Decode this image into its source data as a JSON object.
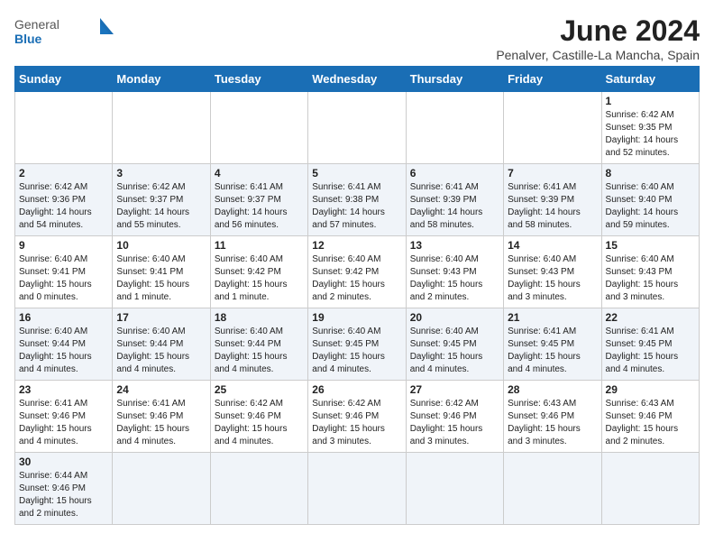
{
  "logo": {
    "text_general": "General",
    "text_blue": "Blue"
  },
  "header": {
    "title": "June 2024",
    "subtitle": "Penalver, Castille-La Mancha, Spain"
  },
  "days_of_week": [
    "Sunday",
    "Monday",
    "Tuesday",
    "Wednesday",
    "Thursday",
    "Friday",
    "Saturday"
  ],
  "weeks": [
    {
      "days": [
        {
          "num": "",
          "info": ""
        },
        {
          "num": "",
          "info": ""
        },
        {
          "num": "",
          "info": ""
        },
        {
          "num": "",
          "info": ""
        },
        {
          "num": "",
          "info": ""
        },
        {
          "num": "",
          "info": ""
        },
        {
          "num": "1",
          "info": "Sunrise: 6:42 AM\nSunset: 9:35 PM\nDaylight: 14 hours and 52 minutes."
        }
      ]
    },
    {
      "days": [
        {
          "num": "2",
          "info": "Sunrise: 6:42 AM\nSunset: 9:36 PM\nDaylight: 14 hours and 54 minutes."
        },
        {
          "num": "3",
          "info": "Sunrise: 6:42 AM\nSunset: 9:37 PM\nDaylight: 14 hours and 55 minutes."
        },
        {
          "num": "4",
          "info": "Sunrise: 6:41 AM\nSunset: 9:37 PM\nDaylight: 14 hours and 56 minutes."
        },
        {
          "num": "5",
          "info": "Sunrise: 6:41 AM\nSunset: 9:38 PM\nDaylight: 14 hours and 57 minutes."
        },
        {
          "num": "6",
          "info": "Sunrise: 6:41 AM\nSunset: 9:39 PM\nDaylight: 14 hours and 58 minutes."
        },
        {
          "num": "7",
          "info": "Sunrise: 6:41 AM\nSunset: 9:39 PM\nDaylight: 14 hours and 58 minutes."
        },
        {
          "num": "8",
          "info": "Sunrise: 6:40 AM\nSunset: 9:40 PM\nDaylight: 14 hours and 59 minutes."
        }
      ]
    },
    {
      "days": [
        {
          "num": "9",
          "info": "Sunrise: 6:40 AM\nSunset: 9:41 PM\nDaylight: 15 hours and 0 minutes."
        },
        {
          "num": "10",
          "info": "Sunrise: 6:40 AM\nSunset: 9:41 PM\nDaylight: 15 hours and 1 minute."
        },
        {
          "num": "11",
          "info": "Sunrise: 6:40 AM\nSunset: 9:42 PM\nDaylight: 15 hours and 1 minute."
        },
        {
          "num": "12",
          "info": "Sunrise: 6:40 AM\nSunset: 9:42 PM\nDaylight: 15 hours and 2 minutes."
        },
        {
          "num": "13",
          "info": "Sunrise: 6:40 AM\nSunset: 9:43 PM\nDaylight: 15 hours and 2 minutes."
        },
        {
          "num": "14",
          "info": "Sunrise: 6:40 AM\nSunset: 9:43 PM\nDaylight: 15 hours and 3 minutes."
        },
        {
          "num": "15",
          "info": "Sunrise: 6:40 AM\nSunset: 9:43 PM\nDaylight: 15 hours and 3 minutes."
        }
      ]
    },
    {
      "days": [
        {
          "num": "16",
          "info": "Sunrise: 6:40 AM\nSunset: 9:44 PM\nDaylight: 15 hours and 4 minutes."
        },
        {
          "num": "17",
          "info": "Sunrise: 6:40 AM\nSunset: 9:44 PM\nDaylight: 15 hours and 4 minutes."
        },
        {
          "num": "18",
          "info": "Sunrise: 6:40 AM\nSunset: 9:44 PM\nDaylight: 15 hours and 4 minutes."
        },
        {
          "num": "19",
          "info": "Sunrise: 6:40 AM\nSunset: 9:45 PM\nDaylight: 15 hours and 4 minutes."
        },
        {
          "num": "20",
          "info": "Sunrise: 6:40 AM\nSunset: 9:45 PM\nDaylight: 15 hours and 4 minutes."
        },
        {
          "num": "21",
          "info": "Sunrise: 6:41 AM\nSunset: 9:45 PM\nDaylight: 15 hours and 4 minutes."
        },
        {
          "num": "22",
          "info": "Sunrise: 6:41 AM\nSunset: 9:45 PM\nDaylight: 15 hours and 4 minutes."
        }
      ]
    },
    {
      "days": [
        {
          "num": "23",
          "info": "Sunrise: 6:41 AM\nSunset: 9:46 PM\nDaylight: 15 hours and 4 minutes."
        },
        {
          "num": "24",
          "info": "Sunrise: 6:41 AM\nSunset: 9:46 PM\nDaylight: 15 hours and 4 minutes."
        },
        {
          "num": "25",
          "info": "Sunrise: 6:42 AM\nSunset: 9:46 PM\nDaylight: 15 hours and 4 minutes."
        },
        {
          "num": "26",
          "info": "Sunrise: 6:42 AM\nSunset: 9:46 PM\nDaylight: 15 hours and 3 minutes."
        },
        {
          "num": "27",
          "info": "Sunrise: 6:42 AM\nSunset: 9:46 PM\nDaylight: 15 hours and 3 minutes."
        },
        {
          "num": "28",
          "info": "Sunrise: 6:43 AM\nSunset: 9:46 PM\nDaylight: 15 hours and 3 minutes."
        },
        {
          "num": "29",
          "info": "Sunrise: 6:43 AM\nSunset: 9:46 PM\nDaylight: 15 hours and 2 minutes."
        }
      ]
    },
    {
      "days": [
        {
          "num": "30",
          "info": "Sunrise: 6:44 AM\nSunset: 9:46 PM\nDaylight: 15 hours and 2 minutes."
        },
        {
          "num": "",
          "info": ""
        },
        {
          "num": "",
          "info": ""
        },
        {
          "num": "",
          "info": ""
        },
        {
          "num": "",
          "info": ""
        },
        {
          "num": "",
          "info": ""
        },
        {
          "num": "",
          "info": ""
        }
      ]
    }
  ]
}
